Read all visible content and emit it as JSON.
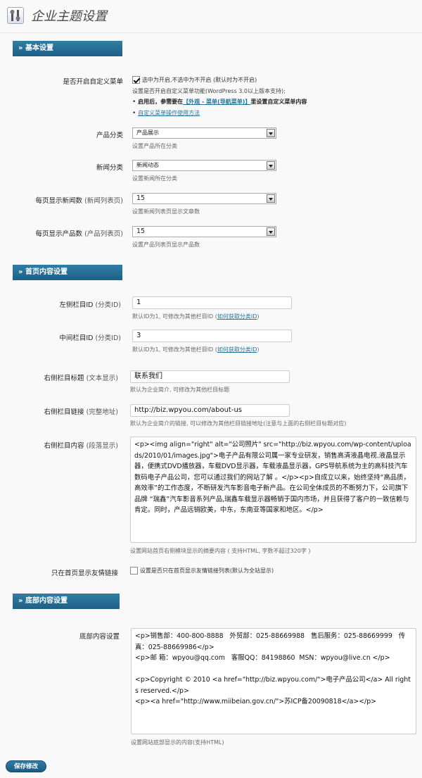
{
  "page": {
    "title": "企业主题设置"
  },
  "sections": {
    "basic": "» 基本设置",
    "home": "» 首页内容设置",
    "footer": "» 底部内容设置"
  },
  "custom_menu": {
    "label": "是否开启自定义菜单",
    "checked": true,
    "option_text": "选中为开启,不选中为不开启 (默认时为不开启)",
    "desc": "设置是否开启自定义菜单功能(WordPress 3.0以上版本支持);",
    "note_prefix": "启用后，参需要在",
    "note_link": "【外观 - 菜单(导航菜单)】",
    "note_suffix": "里设置自定义菜单内容",
    "help_link": "自定义菜单操作使用方法"
  },
  "product_category": {
    "label": "产品分类",
    "value": "产品展示",
    "desc": "设置产品所在分类"
  },
  "news_category": {
    "label": "新闻分类",
    "value": "新闻动态",
    "desc": "设置新闻所在分类"
  },
  "news_per_page": {
    "label": "每页显示新闻数",
    "label_sub": "(新闻列表页)",
    "value": "15",
    "desc": "设置新闻列表页显示文章数"
  },
  "products_per_page": {
    "label": "每页显示产品数",
    "label_sub": "(产品列表页)",
    "value": "15",
    "desc": "设置产品列表页显示产品数"
  },
  "left_column_id": {
    "label": "左侧栏目ID",
    "label_sub": "(分类ID)",
    "value": "1",
    "desc": "默认ID为1, 可修改为其他栏目ID (",
    "desc_link": "如何获取分类ID",
    "desc_end": ")"
  },
  "middle_column_id": {
    "label": "中间栏目ID",
    "label_sub": "(分类ID)",
    "value": "3",
    "desc": "默认ID为1, 可修改为其他栏目ID (",
    "desc_link": "如何获取分类ID",
    "desc_end": ")"
  },
  "right_column_title": {
    "label": "右侧栏目标题",
    "label_sub": "(文本显示)",
    "value": "联系我们",
    "desc": "默认为企业简介, 可修改为其他栏目标题"
  },
  "right_column_link": {
    "label": "右侧栏目链接",
    "label_sub": "(完整地址)",
    "value": "http://biz.wpyou.com/about-us",
    "desc": "默认为企业简介的链接, 可以修改为其他栏目链接地址(注意与上面的右侧栏目标题对应)"
  },
  "right_column_content": {
    "label": "右侧栏目内容",
    "label_sub": "(段落显示)",
    "value": "<p><img align=\"right\" alt=\"公司照片\" src=\"http://biz.wpyou.com/wp-content/uploads/2010/01/images.jpg\">电子产品有限公司属一家专业研发，销售高清液晶电视.液晶显示器，便携式DVD播放器，车载DVD显示器，车载液晶显示器，GPS导航系统为主的高科技汽车数码电子产品公司，您可以通过我们的网站了解 。</p><p>自成立以来，始终坚持“高品质，高效率”的工作态度，不断研发汽车影音电子新产品。在公司全体成员的不断努力下，公司旗下品牌 “瑞鑫”汽车影音系列产品,瑞鑫车载显示器畅销于国内市场，并且获得了客户的一致信赖与肯定。同时，产品远销欧美，中东，东南亚等国家和地区。</p>",
    "desc": "设置网站首页右侧模块显示的摘要内容 ( 支持HTML, 字数不超过320字 )"
  },
  "home_only_links": {
    "label": "只在首页显示友情链接",
    "checked": false,
    "option_text": "设置是否只在首页显示友情链接列表(默认为全站显示)"
  },
  "footer_content": {
    "label": "底部内容设置",
    "value": "<p>销售部：400-800-8888   外贸部：025-88669988   售后服务：025-88669999   传 真：025-88669986</p>\n<p>邮 箱：wpyou@qq.com   客服QQ：84198860  MSN：wpyou@live.cn </p>\n\n<p>Copyright © 2010 <a href=\"http://biz.wpyou.com/\">电子产品公司</a> All rights reserved.</p>\n<p><a href=\"http://www.miibeian.gov.cn/\">苏ICP备20090818</a></p>",
    "desc": "设置网站底部显示的内容(支持HTML)"
  },
  "save_button": "保存修改",
  "colors": {
    "accent": "#21759b",
    "section_bar": "#26698f"
  }
}
